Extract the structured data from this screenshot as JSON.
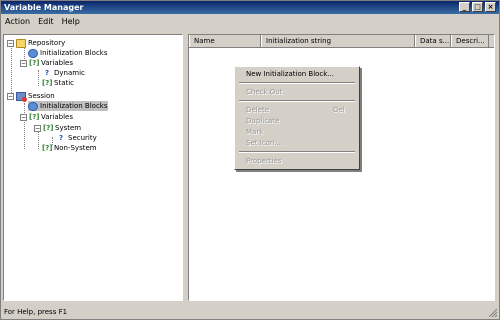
{
  "window": {
    "title": "Variable Manager"
  },
  "controls": {
    "minimize": "_",
    "maximize": "□",
    "close": "×"
  },
  "menubar": {
    "items": [
      "Action",
      "Edit",
      "Help"
    ]
  },
  "tree": {
    "items": [
      {
        "label": "Repository"
      },
      {
        "label": "Initialization Blocks"
      },
      {
        "label": "Variables"
      },
      {
        "label": "Dynamic"
      },
      {
        "label": "Static"
      },
      {
        "label": "Session"
      },
      {
        "label": "Initialization Blocks"
      },
      {
        "label": "Variables"
      },
      {
        "label": "System"
      },
      {
        "label": "Security"
      },
      {
        "label": "Non-System"
      }
    ]
  },
  "table": {
    "columns": [
      "Name",
      "Initialization string",
      "Data s...",
      "Descri..."
    ]
  },
  "context_menu": {
    "items": [
      {
        "label": "New Initialization Block...",
        "enabled": true
      },
      {
        "label": "Check Out",
        "enabled": false
      },
      {
        "label": "Delete",
        "shortcut": "Del",
        "enabled": false
      },
      {
        "label": "Duplicate",
        "enabled": false
      },
      {
        "label": "Mark",
        "enabled": false
      },
      {
        "label": "Set Icon...",
        "enabled": false
      },
      {
        "label": "Properties",
        "enabled": false
      }
    ]
  },
  "statusbar": {
    "text": "For Help, press F1"
  },
  "icons": {
    "folder": "folder-icon",
    "database": "database-icon",
    "variable": "variable-icon",
    "session": "session-icon"
  }
}
